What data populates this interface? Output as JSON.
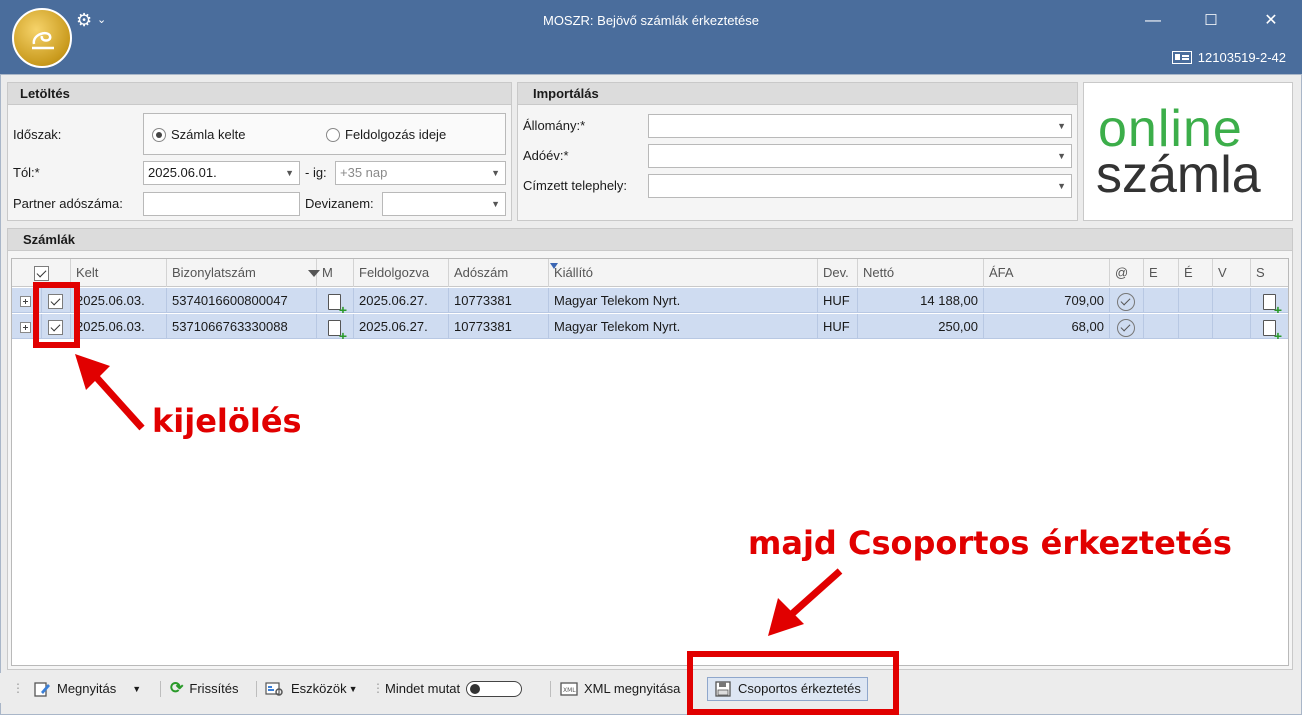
{
  "window": {
    "title": "MOSZR: Bejövő számlák érkeztetése",
    "tax_id": "12103519-2-42",
    "minimize": "—",
    "maximize": "☐",
    "close": "✕"
  },
  "download": {
    "header": "Letöltés",
    "period_label": "Időszak:",
    "radio_invoice_date": "Számla kelte",
    "radio_processing_date": "Feldolgozás ideje",
    "from_label": "Tól:*",
    "from_value": "2025.06.01.",
    "to_label": "- ig:",
    "to_placeholder": "+35 nap",
    "partner_label": "Partner adószáma:",
    "currency_label": "Devizanem:"
  },
  "import": {
    "header": "Importálás",
    "file_label": "Állomány:*",
    "tax_year_label": "Adóév:*",
    "site_label": "Címzett telephely:"
  },
  "brand": {
    "line1": "online",
    "line2": "számla",
    "green": "#3cae4a"
  },
  "invoices": {
    "header": "Számlák",
    "columns": [
      "Kelt",
      "Bizonylatszám",
      "M",
      "Feldolgozva",
      "Adószám",
      "Kiállító",
      "Dev.",
      "Nettó",
      "ÁFA",
      "@",
      "E",
      "É",
      "V",
      "S"
    ],
    "rows": [
      {
        "kelt": "2025.06.03.",
        "bizonylatszam": "5374016600800047",
        "feldolgozva": "2025.06.27.",
        "adoszam": "10773381",
        "kiallito": "Magyar Telekom Nyrt.",
        "dev": "HUF",
        "netto": "14 188,00",
        "afa": "709,00"
      },
      {
        "kelt": "2025.06.03.",
        "bizonylatszam": "5371066763330088",
        "feldolgozva": "2025.06.27.",
        "adoszam": "10773381",
        "kiallito": "Magyar Telekom Nyrt.",
        "dev": "HUF",
        "netto": "250,00",
        "afa": "68,00"
      }
    ]
  },
  "toolbar": {
    "open": "Megnyitás",
    "refresh": "Frissítés",
    "tools": "Eszközök",
    "show_all": "Mindet mutat",
    "xml_open": "XML megnyitása",
    "group_receive": "Csoportos érkeztetés"
  },
  "annotations": {
    "select": "kijelölés",
    "then_group": "majd Csoportos érkeztetés",
    "color": "#e10000"
  }
}
